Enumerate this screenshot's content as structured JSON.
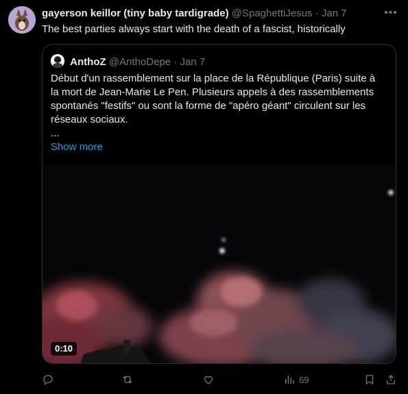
{
  "post": {
    "author": {
      "display_name": "gayerson keillor (tiny baby tardigrade)",
      "handle": "@SpaghettiJesus",
      "separator": "·",
      "date": "Jan 7"
    },
    "text": "The best parties always start with the death of a fascist, historically"
  },
  "quote": {
    "author": {
      "display_name": "AnthoZ",
      "handle": "@AnthoDepe",
      "separator": "·",
      "date": "Jan 7"
    },
    "text_line1": "Début d'un rassemblement sur la place de la République (Paris) suite à",
    "text_line2": "la mort de Jean-Marie Le Pen. Plusieurs appels à des rassemblements",
    "text_line3": "spontanés \"festifs\" ou sont la forme de \"apéro géant\" circulent sur les",
    "text_line4": "réseaux sociaux.",
    "ellipsis": "...",
    "show_more": "Show more",
    "video": {
      "duration": "0:10"
    }
  },
  "actions": {
    "views": "69",
    "icons": [
      "reply-icon",
      "retweet-icon",
      "like-icon",
      "views-icon",
      "bookmark-icon",
      "share-icon"
    ]
  },
  "colors": {
    "background": "#000000",
    "text": "#e7e9ea",
    "muted": "#71767b",
    "link": "#1d9bf0",
    "border": "#2f3336"
  }
}
